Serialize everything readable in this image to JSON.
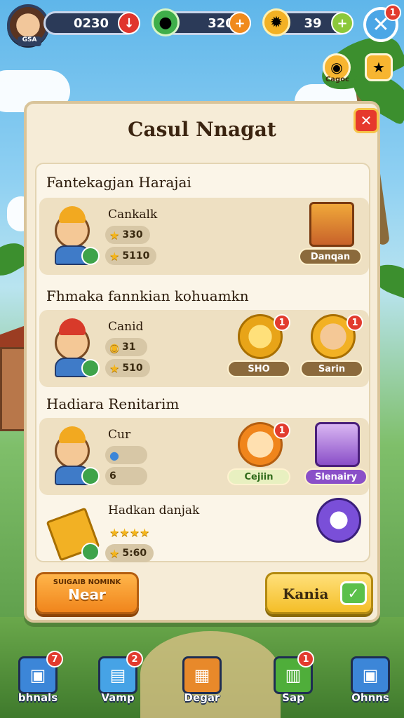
{
  "player": {
    "avatar_tag": "GSA"
  },
  "resources": [
    {
      "value": "0230",
      "icon": "timer-icon",
      "button": "minus-icon"
    },
    {
      "value": "320",
      "icon": "gem-icon",
      "button": "plus-icon"
    },
    {
      "value": "39",
      "icon": "gear-coin-icon",
      "button": "plus-icon"
    }
  ],
  "top_close_badge": "1",
  "side": {
    "coin_label": "Cagoc"
  },
  "panel": {
    "title": "Casul Nnagat",
    "sections": [
      {
        "title": "Fantekagjan Harajai",
        "rows": [
          {
            "name": "Cankalk",
            "stats": [
              "330",
              "5110"
            ],
            "rewards": [
              {
                "label": "Danqan",
                "icon": "treasure-chest-icon",
                "badge": ""
              }
            ]
          }
        ]
      },
      {
        "title": "Fhmaka fannkian kohuamkn",
        "rows": [
          {
            "name": "Canid",
            "stats": [
              "31",
              "510"
            ],
            "rewards": [
              {
                "label": "SHO",
                "icon": "gold-gear-icon",
                "badge": "1"
              },
              {
                "label": "Sarin",
                "icon": "star-hero-icon",
                "badge": "1"
              }
            ]
          }
        ]
      },
      {
        "title": "Hadiara Renitarim",
        "rows": [
          {
            "name": "Cur",
            "stats": [
              "",
              "6"
            ],
            "rewards": [
              {
                "label": "Cejiin",
                "icon": "sun-face-icon",
                "badge": "1"
              },
              {
                "label": "Slenairy",
                "icon": "portrait-card-icon",
                "badge": ""
              }
            ]
          },
          {
            "name": "Hadkan danjak",
            "stats": [
              "★★★★",
              "5:60"
            ],
            "rewards": [
              {
                "label": "",
                "icon": "purple-robot-icon",
                "badge": ""
              }
            ]
          }
        ]
      }
    ],
    "btn_left_sub": "SUIGAIB NOMINK",
    "btn_left_main": "Near",
    "btn_right": "Kania"
  },
  "nav": [
    {
      "label": "bhnals",
      "icon": "blue-box-icon",
      "badge": "7",
      "color": "#3c86d8"
    },
    {
      "label": "Vamp",
      "icon": "map-box-icon",
      "badge": "2",
      "color": "#46a3e6"
    },
    {
      "label": "Degar",
      "icon": "gift-box-icon",
      "badge": "",
      "color": "#e8892a"
    },
    {
      "label": "Sap",
      "icon": "green-box-icon",
      "badge": "1",
      "color": "#4fae3a"
    },
    {
      "label": "Ohnns",
      "icon": "chest-icon",
      "badge": "",
      "color": "#3c86d8"
    }
  ]
}
